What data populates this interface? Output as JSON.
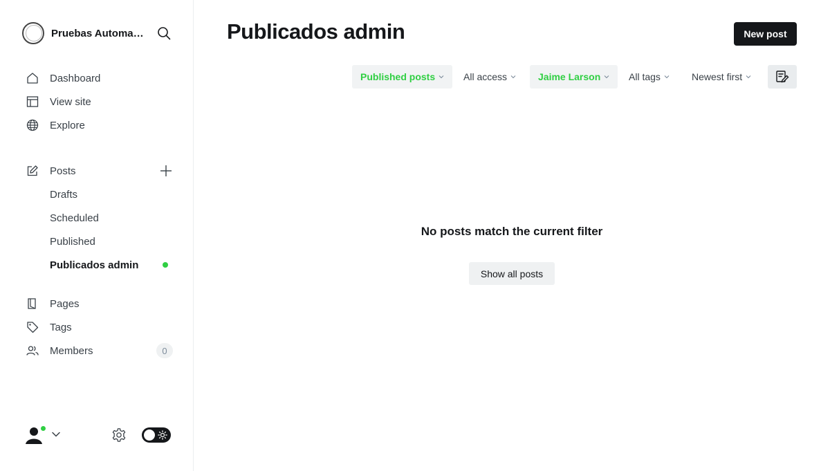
{
  "sidebar": {
    "site_title": "Pruebas Automatizadas",
    "main_nav": [
      {
        "label": "Dashboard",
        "icon": "home-icon"
      },
      {
        "label": "View site",
        "icon": "layout-icon"
      },
      {
        "label": "Explore",
        "icon": "globe-icon"
      }
    ],
    "posts": {
      "label": "Posts",
      "icon": "edit-icon"
    },
    "post_views": [
      {
        "label": "Drafts"
      },
      {
        "label": "Scheduled"
      },
      {
        "label": "Published"
      },
      {
        "label": "Publicados admin",
        "active": true
      }
    ],
    "secondary_nav": [
      {
        "label": "Pages",
        "icon": "page-icon"
      },
      {
        "label": "Tags",
        "icon": "tag-icon"
      },
      {
        "label": "Members",
        "icon": "members-icon",
        "count": "0"
      }
    ]
  },
  "header": {
    "title": "Publicados admin",
    "new_post_label": "New post"
  },
  "filters": [
    {
      "label": "Published posts",
      "active": true
    },
    {
      "label": "All access",
      "active": false
    },
    {
      "label": "Jaime Larson",
      "active": true
    },
    {
      "label": "All tags",
      "active": false
    },
    {
      "label": "Newest first",
      "active": false
    }
  ],
  "empty_state": {
    "message": "No posts match the current filter",
    "button_label": "Show all posts"
  },
  "colors": {
    "accent_green": "#30cf43",
    "primary_dark": "#15171a"
  }
}
